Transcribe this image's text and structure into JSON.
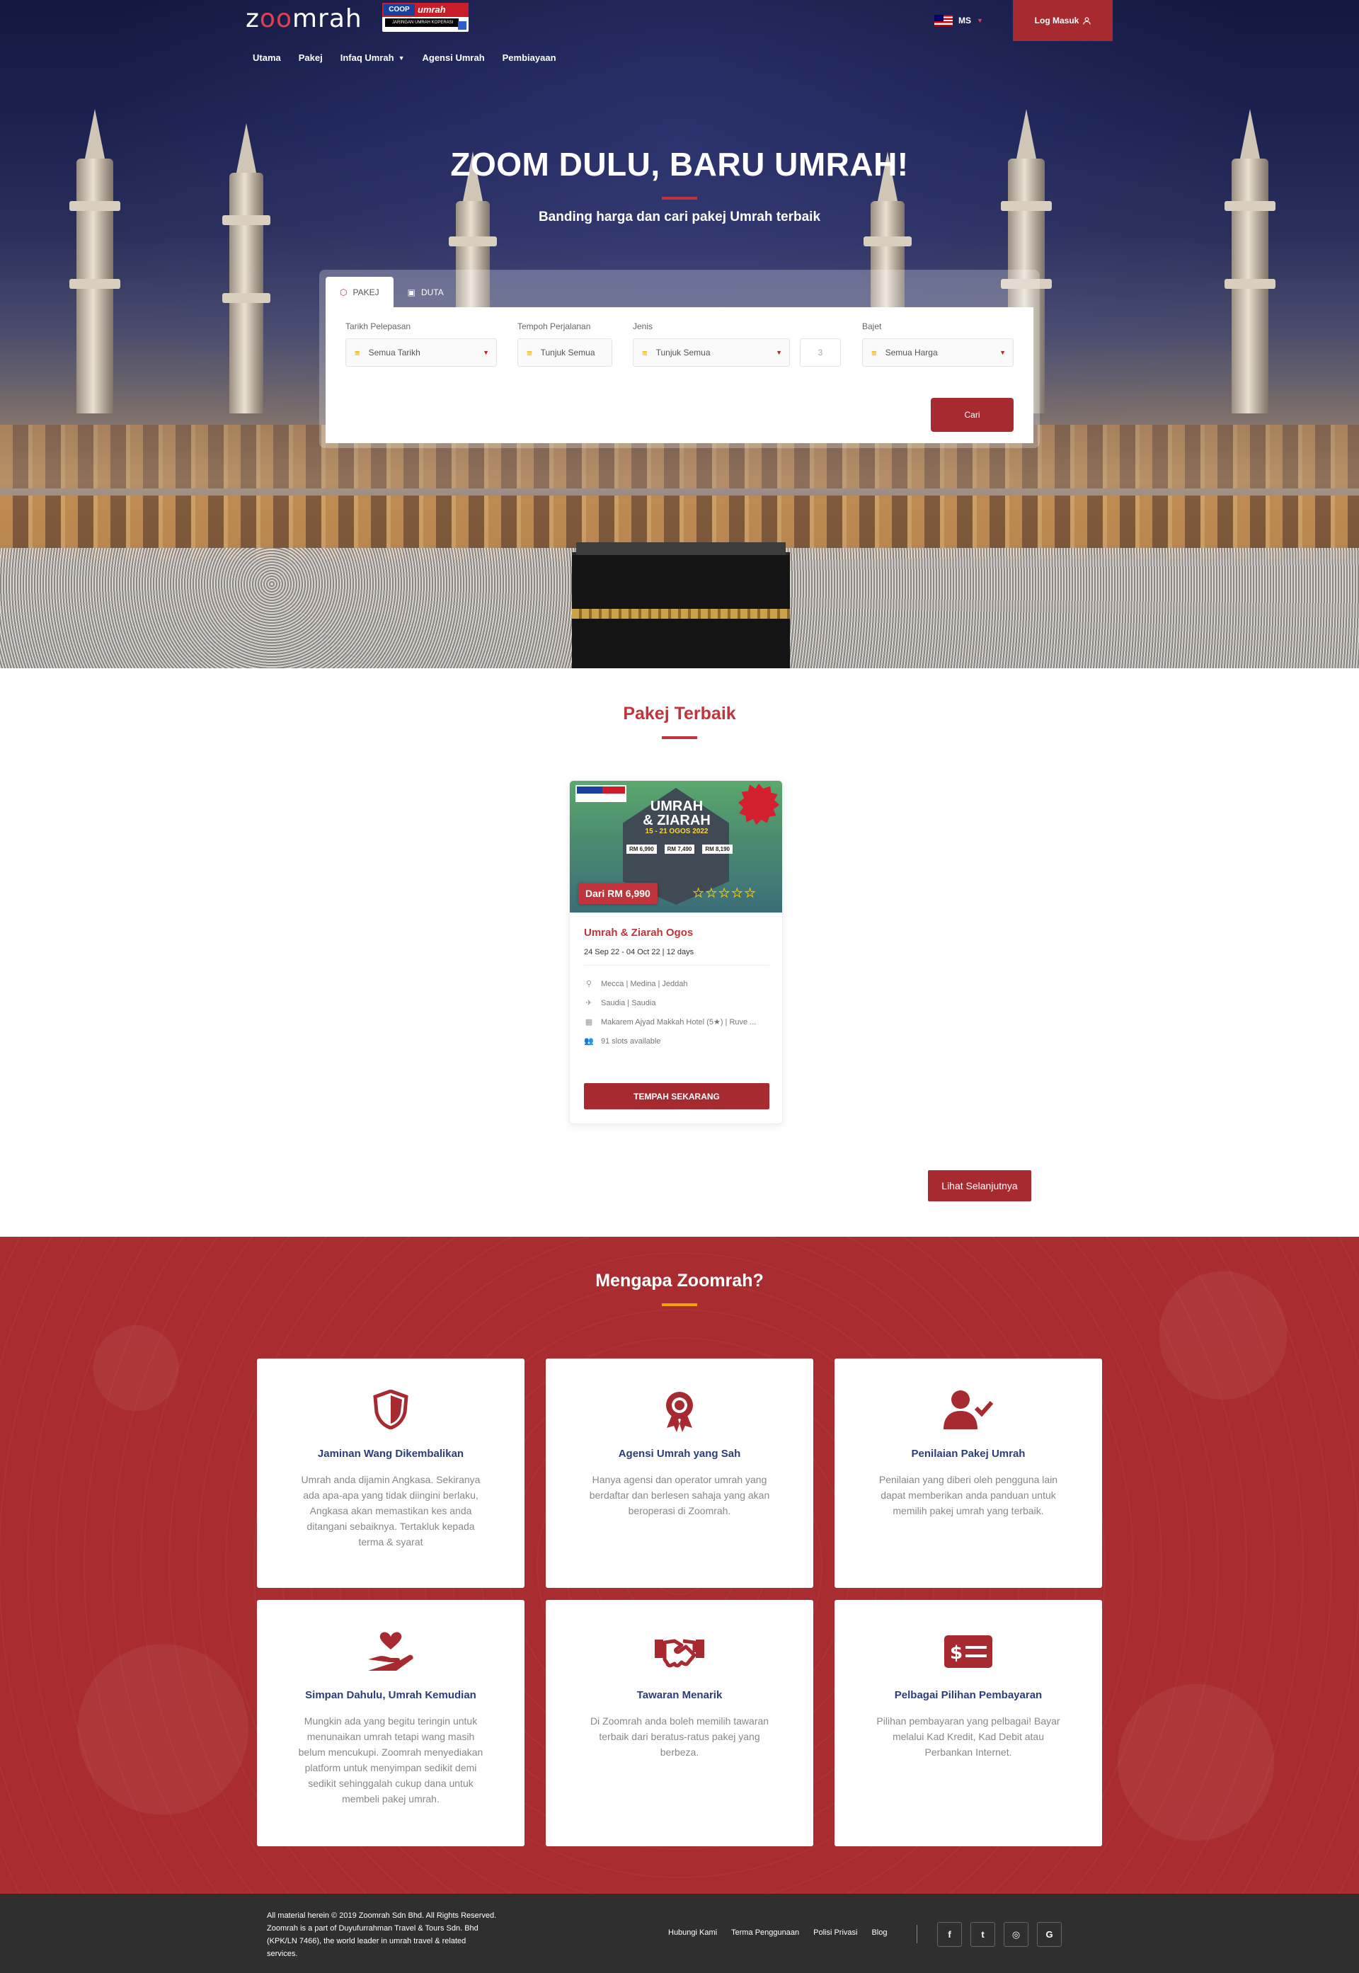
{
  "header": {
    "logo_text": "zoomrah",
    "coop_badge": {
      "top": "umrah",
      "coop": "COOP",
      "sub": "JARINGAN UMRAH KOPERASI"
    },
    "language": "MS",
    "login_label": "Log Masuk",
    "nav": [
      {
        "label": "Utama"
      },
      {
        "label": "Pakej"
      },
      {
        "label": "Infaq Umrah"
      },
      {
        "label": "Agensi Umrah"
      },
      {
        "label": "Pembiayaan"
      }
    ]
  },
  "hero": {
    "title": "ZOOM DULU, BARU UMRAH!",
    "subtitle": "Banding harga dan cari pakej Umrah terbaik"
  },
  "search": {
    "tabs": [
      {
        "label": "PAKEJ",
        "icon": "box-icon",
        "active": true
      },
      {
        "label": "DUTA",
        "icon": "id-card-icon",
        "active": false
      }
    ],
    "fields": {
      "departure": {
        "label": "Tarikh Pelepasan",
        "value": "Semua Tarikh"
      },
      "duration": {
        "label": "Tempoh Perjalanan",
        "value": "Tunjuk Semua"
      },
      "type": {
        "label": "Jenis",
        "value": "Tunjuk Semua"
      },
      "count": {
        "value": "3"
      },
      "budget": {
        "label": "Bajet",
        "value": "Semua Harga"
      }
    },
    "submit_label": "Cari"
  },
  "best_packages": {
    "title": "Pakej Terbaik",
    "card": {
      "poster": {
        "title_line1": "UMRAH",
        "title_line2": "& ZIARAH",
        "dates": "15 - 21 OGOS 2022",
        "prices": [
          "RM 6,990",
          "RM 7,490",
          "RM 8,190"
        ]
      },
      "price_tag": "Dari RM 6,990",
      "rating_stars": 5,
      "name": "Umrah & Ziarah Ogos",
      "dates": "24 Sep 22 - 04 Oct 22 | 12 days",
      "location": "Mecca | Medina | Jeddah",
      "airline": "Saudia | Saudia",
      "hotel": "Makarem Ajyad Makkah Hotel (5★) | Ruve ...",
      "slots": "91 slots available",
      "book_label": "TEMPAH SEKARANG"
    },
    "more_label": "Lihat Selanjutnya"
  },
  "why": {
    "title": "Mengapa Zoomrah?",
    "items": [
      {
        "icon": "shield-icon",
        "title": "Jaminan Wang Dikembalikan",
        "text": "Umrah anda dijamin Angkasa. Sekiranya ada apa-apa yang tidak diingini berlaku, Angkasa akan memastikan kes anda ditangani sebaiknya. Tertakluk kepada terma & syarat"
      },
      {
        "icon": "award-icon",
        "title": "Agensi Umrah yang Sah",
        "text": "Hanya agensi dan operator umrah yang berdaftar dan berlesen sahaja yang akan beroperasi di Zoomrah."
      },
      {
        "icon": "user-check-icon",
        "title": "Penilaian Pakej Umrah",
        "text": "Penilaian yang diberi oleh pengguna lain dapat memberikan anda panduan untuk memilih pakej umrah yang terbaik."
      },
      {
        "icon": "hand-heart-icon",
        "title": "Simpan Dahulu, Umrah Kemudian",
        "text": "Mungkin ada yang begitu teringin untuk menunaikan umrah tetapi wang masih belum mencukupi. Zoomrah menyediakan platform untuk menyimpan sedikit demi sedikit sehinggalah cukup dana untuk membeli pakej umrah."
      },
      {
        "icon": "handshake-icon",
        "title": "Tawaran Menarik",
        "text": "Di Zoomrah anda boleh memilih tawaran terbaik dari beratus-ratus pakej yang berbeza."
      },
      {
        "icon": "money-check-icon",
        "title": "Pelbagai Pilihan Pembayaran",
        "text": "Pilihan pembayaran yang pelbagai! Bayar melalui Kad Kredit, Kad Debit atau Perbankan Internet."
      }
    ]
  },
  "footer": {
    "copyright_lines": [
      "All material herein © 2019 Zoomrah Sdn Bhd. All Rights Reserved.",
      "Zoomrah is a part of Duyufurrahman Travel & Tours Sdn. Bhd",
      "(KPK/LN 7466), the world leader in umrah travel & related",
      "services."
    ],
    "links": [
      "Hubungi Kami",
      "Terma Penggunaan",
      "Polisi Privasi",
      "Blog"
    ],
    "socials": [
      {
        "icon": "facebook-icon",
        "glyph": "f"
      },
      {
        "icon": "twitter-icon",
        "glyph": "t"
      },
      {
        "icon": "instagram-icon",
        "glyph": "◎"
      },
      {
        "icon": "google-icon",
        "glyph": "G"
      }
    ]
  },
  "colors": {
    "brand_red": "#a62a2f",
    "title_red": "#c0343b",
    "navy": "#2c3e7a",
    "footer": "#2f2f2f",
    "accent_yellow": "#f0a500"
  }
}
